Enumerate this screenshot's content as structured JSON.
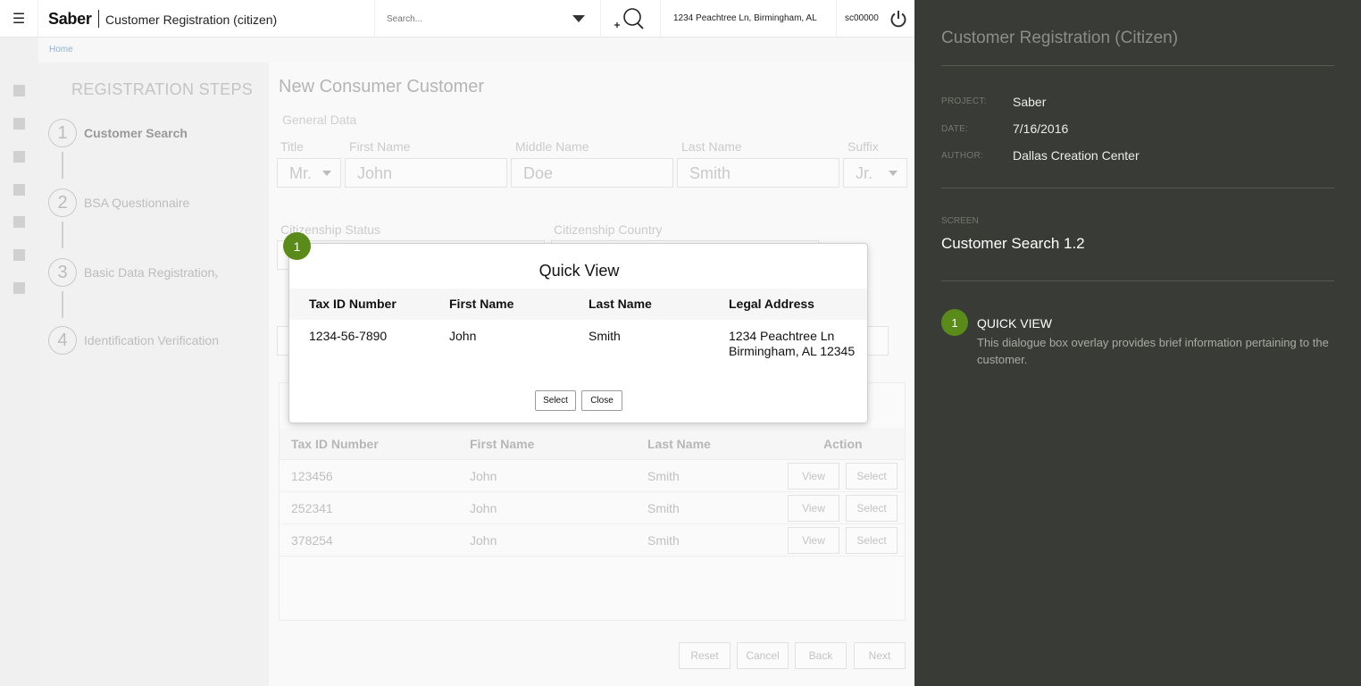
{
  "header": {
    "brand": "Saber",
    "app_title": "Customer Registration (citizen)",
    "search_placeholder": "Search...",
    "address": "1234 Peachtree Ln, Birmingham, AL",
    "user_id": "sc00000",
    "menu_icon": "hamburger-icon",
    "search_icon": "add-search-icon",
    "power_icon": "power-icon"
  },
  "breadcrumb": {
    "home": "Home"
  },
  "steps": {
    "title": "REGISTRATION STEPS",
    "items": [
      {
        "num": "1",
        "label": "Customer Search"
      },
      {
        "num": "2",
        "label": "BSA Questionnaire"
      },
      {
        "num": "3",
        "label": "Basic Data Registration"
      },
      {
        "num": "4",
        "label": "Identification Verification"
      }
    ]
  },
  "form": {
    "title": "New Consumer Customer",
    "section": "General Data",
    "labels": {
      "title": "Title",
      "first_name": "First Name",
      "middle_name": "Middle Name",
      "last_name": "Last Name",
      "suffix": "Suffix",
      "citizenship_status": "Citizenship Status",
      "citizenship_country": "Citizenship Country"
    },
    "values": {
      "title": "Mr.",
      "first_name": "John",
      "middle_name": "Doe",
      "last_name": "Smith",
      "suffix": "Jr."
    }
  },
  "results": {
    "headers": [
      "Tax ID Number",
      "First Name",
      "Last Name",
      "Action"
    ],
    "rows": [
      {
        "tax_id": "123456",
        "first": "John",
        "last": "Smith"
      },
      {
        "tax_id": "252341",
        "first": "John",
        "last": "Smith"
      },
      {
        "tax_id": "378254",
        "first": "John",
        "last": "Smith"
      }
    ],
    "view_label": "View",
    "select_label": "Select"
  },
  "footer_buttons": {
    "reset": "Reset",
    "cancel": "Cancel",
    "back": "Back",
    "next": "Next"
  },
  "modal": {
    "marker": "1",
    "title": "Quick View",
    "headers": [
      "Tax ID Number",
      "First Name",
      "Last Name",
      "Legal Address"
    ],
    "row": {
      "tax_id": "1234-56-7890",
      "first": "John",
      "last": "Smith",
      "address_line1": "1234 Peachtree Ln",
      "address_line2": "Birmingham, AL 12345"
    },
    "select_label": "Select",
    "close_label": "Close"
  },
  "spec": {
    "title": "Customer Registration (Citizen)",
    "project_key": "PROJECT:",
    "project": "Saber",
    "date_key": "DATE:",
    "date": "7/16/2016",
    "author_key": "AUTHOR:",
    "author": "Dallas Creation Center",
    "screen_key": "SCREEN",
    "screen": "Customer Search 1.2",
    "note_num": "1",
    "note_title": "QUICK VIEW",
    "note_desc": "This dialogue box overlay provides brief information pertaining to the customer."
  },
  "colors": {
    "accent_green": "#5a8a1a",
    "spec_bg": "#393b36",
    "link_blue": "#8eb1d6"
  }
}
